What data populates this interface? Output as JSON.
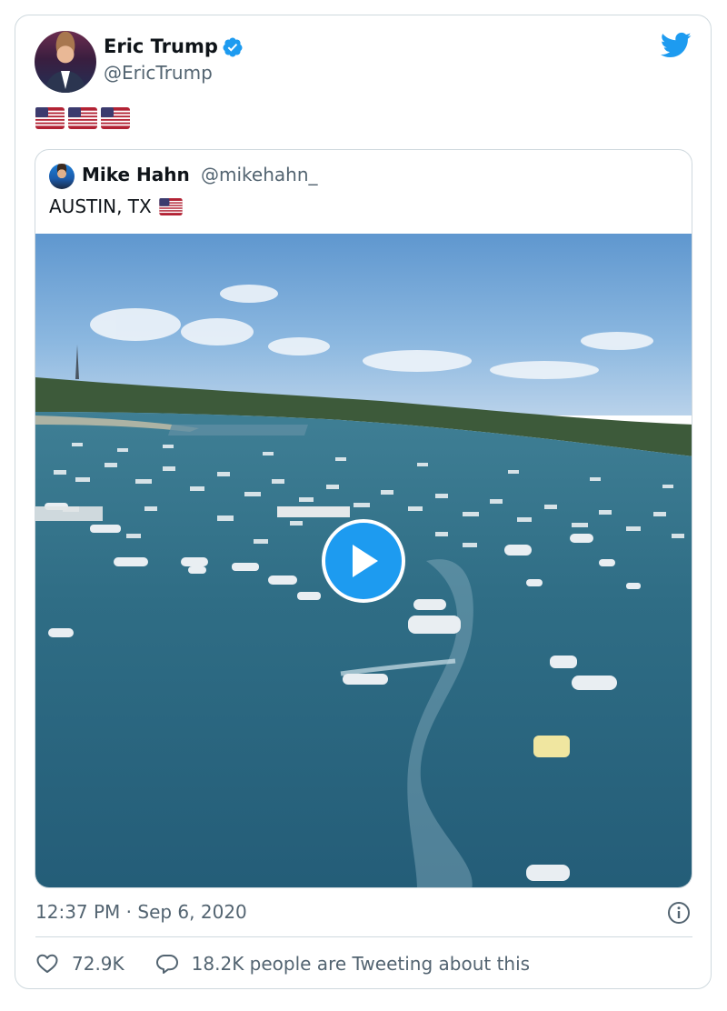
{
  "tweet": {
    "author_name": "Eric Trump",
    "author_handle": "@EricTrump",
    "verified": true,
    "body_emoji": [
      "flag-us",
      "flag-us",
      "flag-us"
    ],
    "timestamp": "12:37 PM · Sep 6, 2020",
    "likes": "72.9K",
    "tweeting_text": "18.2K people are Tweeting about this"
  },
  "quoted_tweet": {
    "author_name": "Mike Hahn",
    "author_handle": "@mikehahn_",
    "text": "AUSTIN, TX",
    "text_emoji": "flag-us",
    "media_type": "video"
  },
  "colors": {
    "accent": "#1d9bf0",
    "text_primary": "#0f1419",
    "text_secondary": "#536471",
    "border": "#cfd9de"
  },
  "icons": {
    "brand": "twitter-bird-icon",
    "verified": "verified-badge-icon",
    "play": "play-icon",
    "info": "info-icon",
    "like": "heart-icon",
    "reply": "reply-bubble-icon"
  }
}
